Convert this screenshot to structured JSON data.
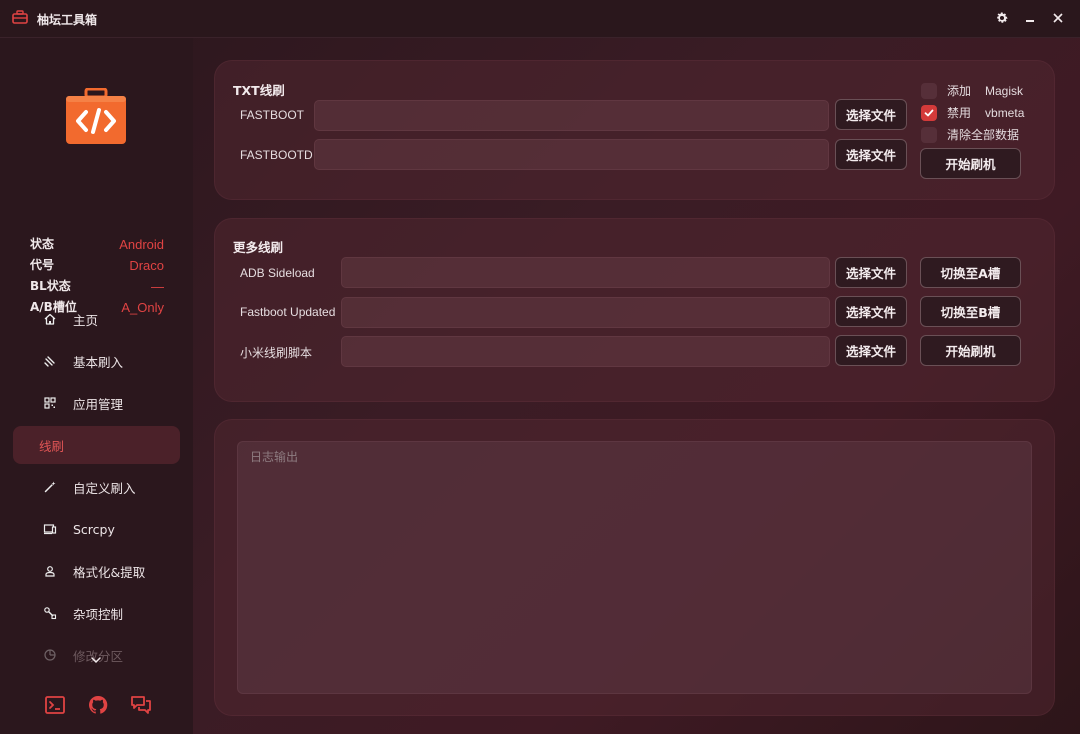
{
  "window": {
    "title": "柚坛工具箱",
    "controls": [
      "gear-icon",
      "minimize-icon",
      "close-icon"
    ]
  },
  "colors": {
    "accent": "#e04343",
    "background": "#3a1c25",
    "sidebar": "#2b171d",
    "logo_orange": "#f26a2e"
  },
  "device_info": [
    {
      "key": "状态",
      "value": "Android"
    },
    {
      "key": "代号",
      "value": "Draco"
    },
    {
      "key": "BL状态",
      "value": "—"
    },
    {
      "key": "A/B槽位",
      "value": "A_Only"
    }
  ],
  "nav": {
    "items": [
      {
        "label": "主页",
        "icon": "home-icon"
      },
      {
        "label": "基本刷入",
        "icon": "flash-icon"
      },
      {
        "label": "应用管理",
        "icon": "apps-icon"
      },
      {
        "label": "线刷",
        "icon": "",
        "active": true
      },
      {
        "label": "自定义刷入",
        "icon": "wand-icon"
      },
      {
        "label": "Scrcpy",
        "icon": "screen-mirror-icon"
      },
      {
        "label": "格式化&提取",
        "icon": "user-format-icon"
      },
      {
        "label": "杂项控制",
        "icon": "wrench-icon"
      },
      {
        "label": "修改分区",
        "icon": "partition-icon"
      }
    ],
    "bottom_icons": [
      "terminal-icon",
      "github-icon",
      "chat-icon"
    ]
  },
  "txt_flash": {
    "title": "TXT线刷",
    "rows": [
      {
        "label": "FASTBOOT",
        "value": "",
        "button": "选择文件"
      },
      {
        "label": "FASTBOOTD",
        "value": "",
        "button": "选择文件"
      }
    ],
    "options": [
      {
        "label": "添加",
        "label2": "Magisk",
        "checked": false
      },
      {
        "label": "禁用",
        "label2": "vbmeta",
        "checked": true
      },
      {
        "label": "清除全部数据",
        "label2": "",
        "checked": false
      }
    ],
    "start_button": "开始刷机"
  },
  "more_flash": {
    "title": "更多线刷",
    "rows": [
      {
        "label": "ADB Sideload",
        "value": "",
        "button": "选择文件",
        "action": "切换至A槽"
      },
      {
        "label": "Fastboot Updated",
        "value": "",
        "button": "选择文件",
        "action": "切换至B槽"
      },
      {
        "label": "小米线刷脚本",
        "value": "",
        "button": "选择文件",
        "action": "开始刷机"
      }
    ]
  },
  "log": {
    "placeholder": "日志输出",
    "value": ""
  }
}
